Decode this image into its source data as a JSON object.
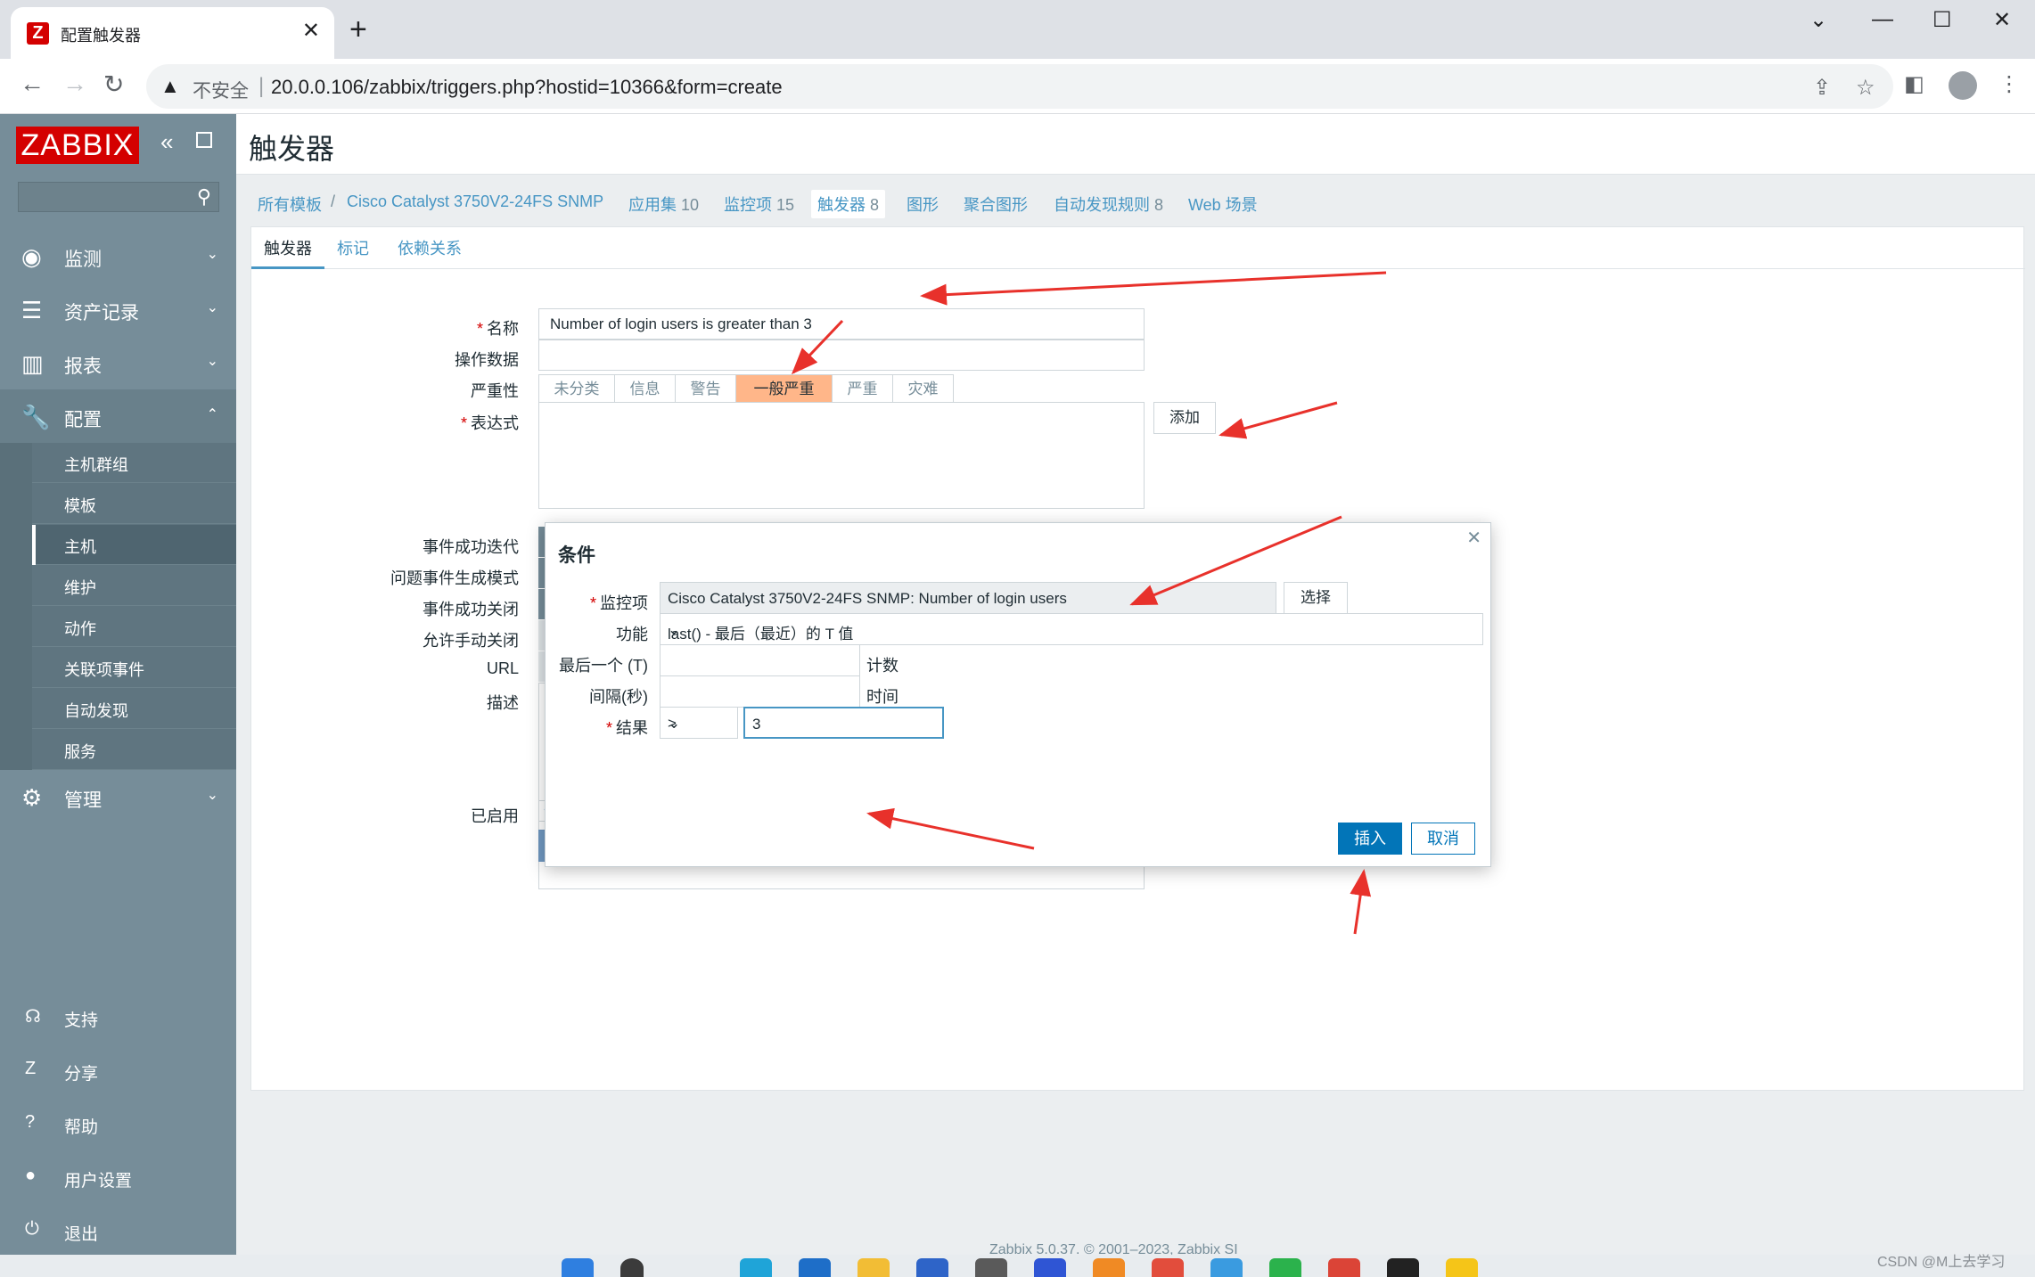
{
  "browser": {
    "tab_title": "配置触发器",
    "tab_favicon": "Z",
    "url_security": "不安全",
    "url": "20.0.0.106/zabbix/triggers.php?hostid=10366&form=create"
  },
  "sidebar": {
    "logo": "ZABBIX",
    "menu": [
      {
        "label": "监测",
        "icon": "eye-icon"
      },
      {
        "label": "资产记录",
        "icon": "list-icon"
      },
      {
        "label": "报表",
        "icon": "chart-icon"
      },
      {
        "label": "配置",
        "icon": "wrench-icon"
      },
      {
        "label": "管理",
        "icon": "gear-icon"
      }
    ],
    "submenu": [
      "主机群组",
      "模板",
      "主机",
      "维护",
      "动作",
      "关联项事件",
      "自动发现",
      "服务"
    ],
    "footer": [
      {
        "label": "支持",
        "icon": "headset-icon"
      },
      {
        "label": "分享",
        "icon": "share-icon"
      },
      {
        "label": "帮助",
        "icon": "help-icon"
      },
      {
        "label": "用户设置",
        "icon": "user-icon"
      },
      {
        "label": "退出",
        "icon": "power-icon"
      }
    ]
  },
  "page": {
    "title": "触发器",
    "breadcrumbs": {
      "all_templates": "所有模板",
      "separator": "/",
      "host": "Cisco Catalyst 3750V2-24FS SNMP",
      "apps": {
        "label": "应用集",
        "count": "10"
      },
      "items": {
        "label": "监控项",
        "count": "15"
      },
      "triggers": {
        "label": "触发器",
        "count": "8"
      },
      "graphs": "图形",
      "screens": "聚合图形",
      "discovery": {
        "label": "自动发现规则",
        "count": "8"
      },
      "web": "Web 场景"
    },
    "tabs": [
      "触发器",
      "标记",
      "依赖关系"
    ],
    "form": {
      "name_label": "名称",
      "name_value": "Number of login users is greater than 3",
      "opdata_label": "操作数据",
      "severity_label": "严重性",
      "severity_options": [
        "未分类",
        "信息",
        "警告",
        "一般严重",
        "严重",
        "灾难"
      ],
      "severity_selected": "一般严重",
      "expression_label": "表达式",
      "add_button": "添加",
      "ok_event_label": "事件成功迭代",
      "problem_mode_label": "问题事件生成模式",
      "ok_close_label": "事件成功关闭",
      "manual_close_label": "允许手动关闭",
      "url_label": "URL",
      "description_label": "描述",
      "enabled_label": "已启用",
      "submit_label": "添加",
      "cancel_label": "取消"
    },
    "footer": "Zabbix 5.0.37. © 2001–2023, Zabbix SI"
  },
  "modal": {
    "title": "条件",
    "item_label": "监控项",
    "item_value": "Cisco Catalyst 3750V2-24FS SNMP: Number of login users",
    "select_button": "选择",
    "function_label": "功能",
    "function_value": "last() - 最后（最近）的 T 值",
    "last_label": "最后一个 (T)",
    "last_value": "",
    "last_unit": "计数",
    "interval_label": "间隔(秒)",
    "interval_value": "",
    "interval_unit": "时间",
    "result_label": "结果",
    "result_operator": ">",
    "result_value": "3",
    "insert_button": "插入",
    "cancel_button": "取消"
  },
  "watermark": "CSDN @M上去学习",
  "colors": {
    "zabbix_red": "#d40000",
    "sidebar": "#768d99",
    "link": "#4796c4",
    "severity_average": "#ffb689",
    "primary": "#0275b8",
    "annotation_arrow": "#e8312b"
  }
}
